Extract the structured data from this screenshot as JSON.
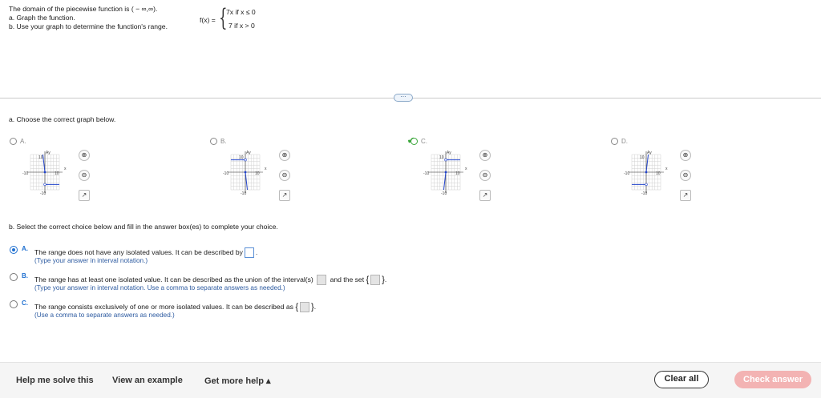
{
  "problem": {
    "line1": "The domain of the piecewise function is ( − ∞,∞).",
    "line2": "a. Graph the function.",
    "line3": "b. Use your graph to determine the function's range."
  },
  "formula": {
    "lhs": "f(x) =",
    "case1": "7x  if  x ≤ 0",
    "case2": "7  if  x > 0"
  },
  "more_button": "⋯",
  "part_a": {
    "prompt": "a. Choose the correct graph below.",
    "choices": [
      {
        "letter": "A.",
        "selected": false
      },
      {
        "letter": "B.",
        "selected": false
      },
      {
        "letter": "C.",
        "selected": true
      },
      {
        "letter": "D.",
        "selected": false
      }
    ],
    "graph_labels": {
      "y": "Ay",
      "x": "x",
      "ymax": "10",
      "ymin": "-10",
      "xmin": "-10",
      "xmax": "10"
    },
    "tool_icons": [
      "zoom-in-icon",
      "zoom-out-icon",
      "popout-icon"
    ],
    "checkmark": "✔"
  },
  "part_b": {
    "prompt": "b. Select the correct choice below and fill in the answer box(es) to complete your choice.",
    "options": [
      {
        "letter": "A.",
        "text": "The range does not have any isolated values. It can be described by",
        "hint": "(Type your answer in interval notation.)",
        "selected": true
      },
      {
        "letter": "B.",
        "text": "The range has at least one isolated value. It can be described as the union of the interval(s)",
        "text2": "and the set",
        "hint": "(Type your answer in interval notation. Use a comma to separate answers as needed.)",
        "selected": false
      },
      {
        "letter": "C.",
        "text": "The range consists exclusively of one or more isolated values. It can be described as",
        "hint": "(Use a comma to separate answers as needed.)",
        "selected": false
      }
    ]
  },
  "footer": {
    "help": "Help me solve this",
    "example": "View an example",
    "more_help": "Get more help ▴",
    "clear": "Clear all",
    "check": "Check answer"
  },
  "colors": {
    "accent": "#1e6fd0",
    "check_btn": "#f3b3b3",
    "graph_line": "#2244cc"
  }
}
